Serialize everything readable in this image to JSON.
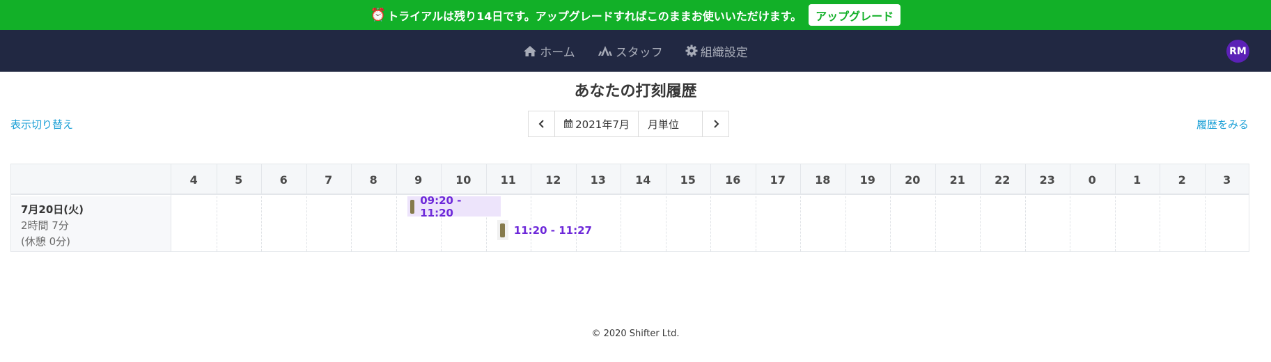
{
  "banner": {
    "message": "トライアルは残り14日です。アップグレードすればこのままお使いいただけます。",
    "upgrade_label": "アップグレード",
    "icon": "alarm-clock-icon",
    "color": "#12b028"
  },
  "nav": {
    "items": [
      {
        "label": "ホーム",
        "icon": "home-icon"
      },
      {
        "label": "スタッフ",
        "icon": "staff-icon"
      },
      {
        "label": "組織設定",
        "icon": "gear-icon"
      }
    ],
    "avatar": "RM",
    "background": "#212842"
  },
  "page": {
    "title": "あなたの打刻履歴",
    "toggle_label": "表示切り替え",
    "history_label": "履歴をみる"
  },
  "period": {
    "month_label": "2021年7月",
    "unit_label": "月単位"
  },
  "timeline": {
    "hours": [
      "4",
      "5",
      "6",
      "7",
      "8",
      "9",
      "10",
      "11",
      "12",
      "13",
      "14",
      "15",
      "16",
      "17",
      "18",
      "19",
      "20",
      "21",
      "22",
      "23",
      "0",
      "1",
      "2",
      "3"
    ],
    "rows": [
      {
        "date": "7月20日(火)",
        "duration": "2時間 7分",
        "break": "(休憩 0分)",
        "shifts": [
          {
            "label": "09:20 - 11:20",
            "start": 9.33,
            "end": 11.33
          },
          {
            "label": "11:20 - 11:27",
            "start": 11.33,
            "end": 11.45
          }
        ]
      }
    ]
  },
  "footer": {
    "copyright": "© 2020 Shifter Ltd."
  }
}
